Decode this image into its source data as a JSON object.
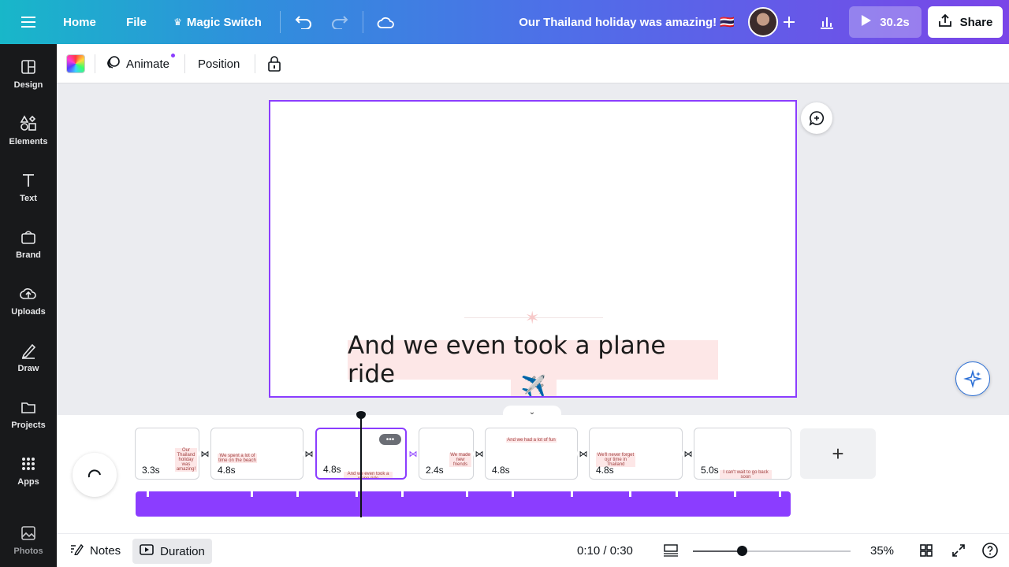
{
  "topbar": {
    "home_label": "Home",
    "file_label": "File",
    "magic_switch_label": "Magic Switch",
    "title": "Our Thailand holiday was amazing! 🇹🇭",
    "play_label": "30.2s",
    "share_label": "Share"
  },
  "sidebar": {
    "items": [
      {
        "label": "Design",
        "icon": "design-icon"
      },
      {
        "label": "Elements",
        "icon": "elements-icon"
      },
      {
        "label": "Text",
        "icon": "text-icon"
      },
      {
        "label": "Brand",
        "icon": "brand-icon"
      },
      {
        "label": "Uploads",
        "icon": "uploads-icon"
      },
      {
        "label": "Draw",
        "icon": "draw-icon"
      },
      {
        "label": "Projects",
        "icon": "projects-icon"
      },
      {
        "label": "Apps",
        "icon": "apps-icon"
      },
      {
        "label": "Photos",
        "icon": "photos-icon"
      }
    ]
  },
  "toolbar": {
    "animate_label": "Animate",
    "position_label": "Position"
  },
  "canvas": {
    "caption": "And we even took a plane ride",
    "emoji": "✈️"
  },
  "timeline": {
    "scenes": [
      {
        "duration": "3.3s",
        "thumb_text": "Our Thailand holiday was amazing!"
      },
      {
        "duration": "4.8s",
        "thumb_text": "We spent a lot of time on the beach"
      },
      {
        "duration": "4.8s",
        "thumb_text": "And we even took a plane ride"
      },
      {
        "duration": "2.4s",
        "thumb_text": "We made new friends"
      },
      {
        "duration": "4.8s",
        "thumb_text": "And we had a lot of fun"
      },
      {
        "duration": "4.8s",
        "thumb_text": "We'll never forget our time in Thailand"
      },
      {
        "duration": "5.0s",
        "thumb_text": "I can't wait to go back soon"
      }
    ],
    "add_scene_label": "+"
  },
  "bottombar": {
    "notes_label": "Notes",
    "duration_label": "Duration",
    "time": "0:10 / 0:30",
    "zoom": "35%",
    "zoom_fraction": 0.31
  },
  "colors": {
    "accent": "#8b3dff",
    "caption_bg": "#fde7e7"
  }
}
